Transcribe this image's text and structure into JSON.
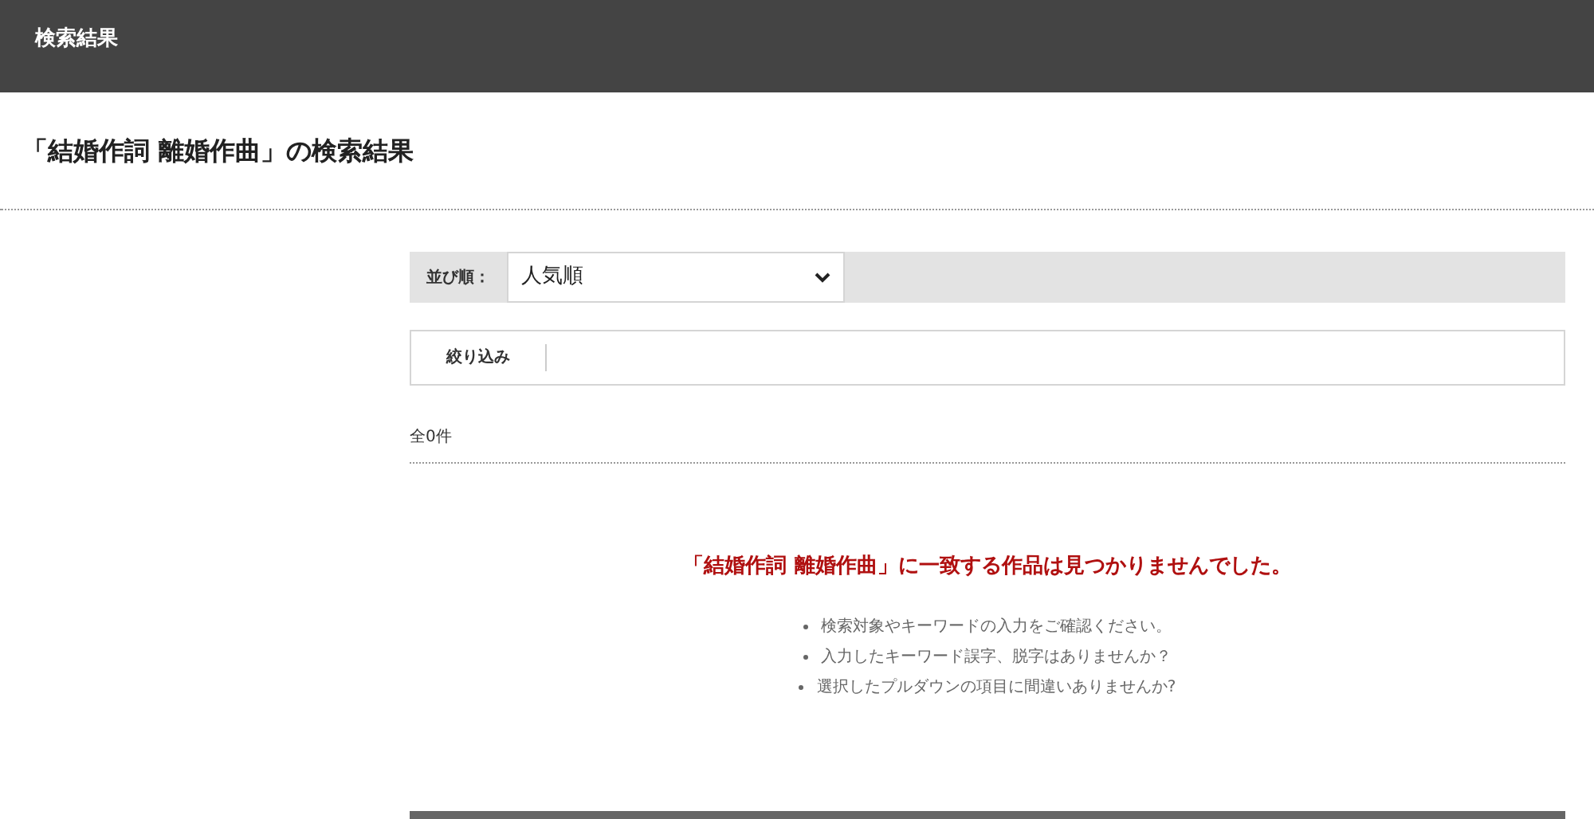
{
  "header": {
    "title": "検索結果"
  },
  "page_title": "「結婚作詞 離婚作曲」の検索結果",
  "sort": {
    "label": "並び順：",
    "value": "人気順"
  },
  "filter": {
    "label": "絞り込み"
  },
  "count": "全0件",
  "no_results": {
    "message": "「結婚作詞 離婚作曲」に一致する作品は見つかりませんでした。",
    "tips": [
      "検索対象やキーワードの入力をご確認ください。",
      "入力したキーワード誤字、脱字はありませんか？",
      "選択したプルダウンの項目に間違いありませんか?"
    ]
  }
}
